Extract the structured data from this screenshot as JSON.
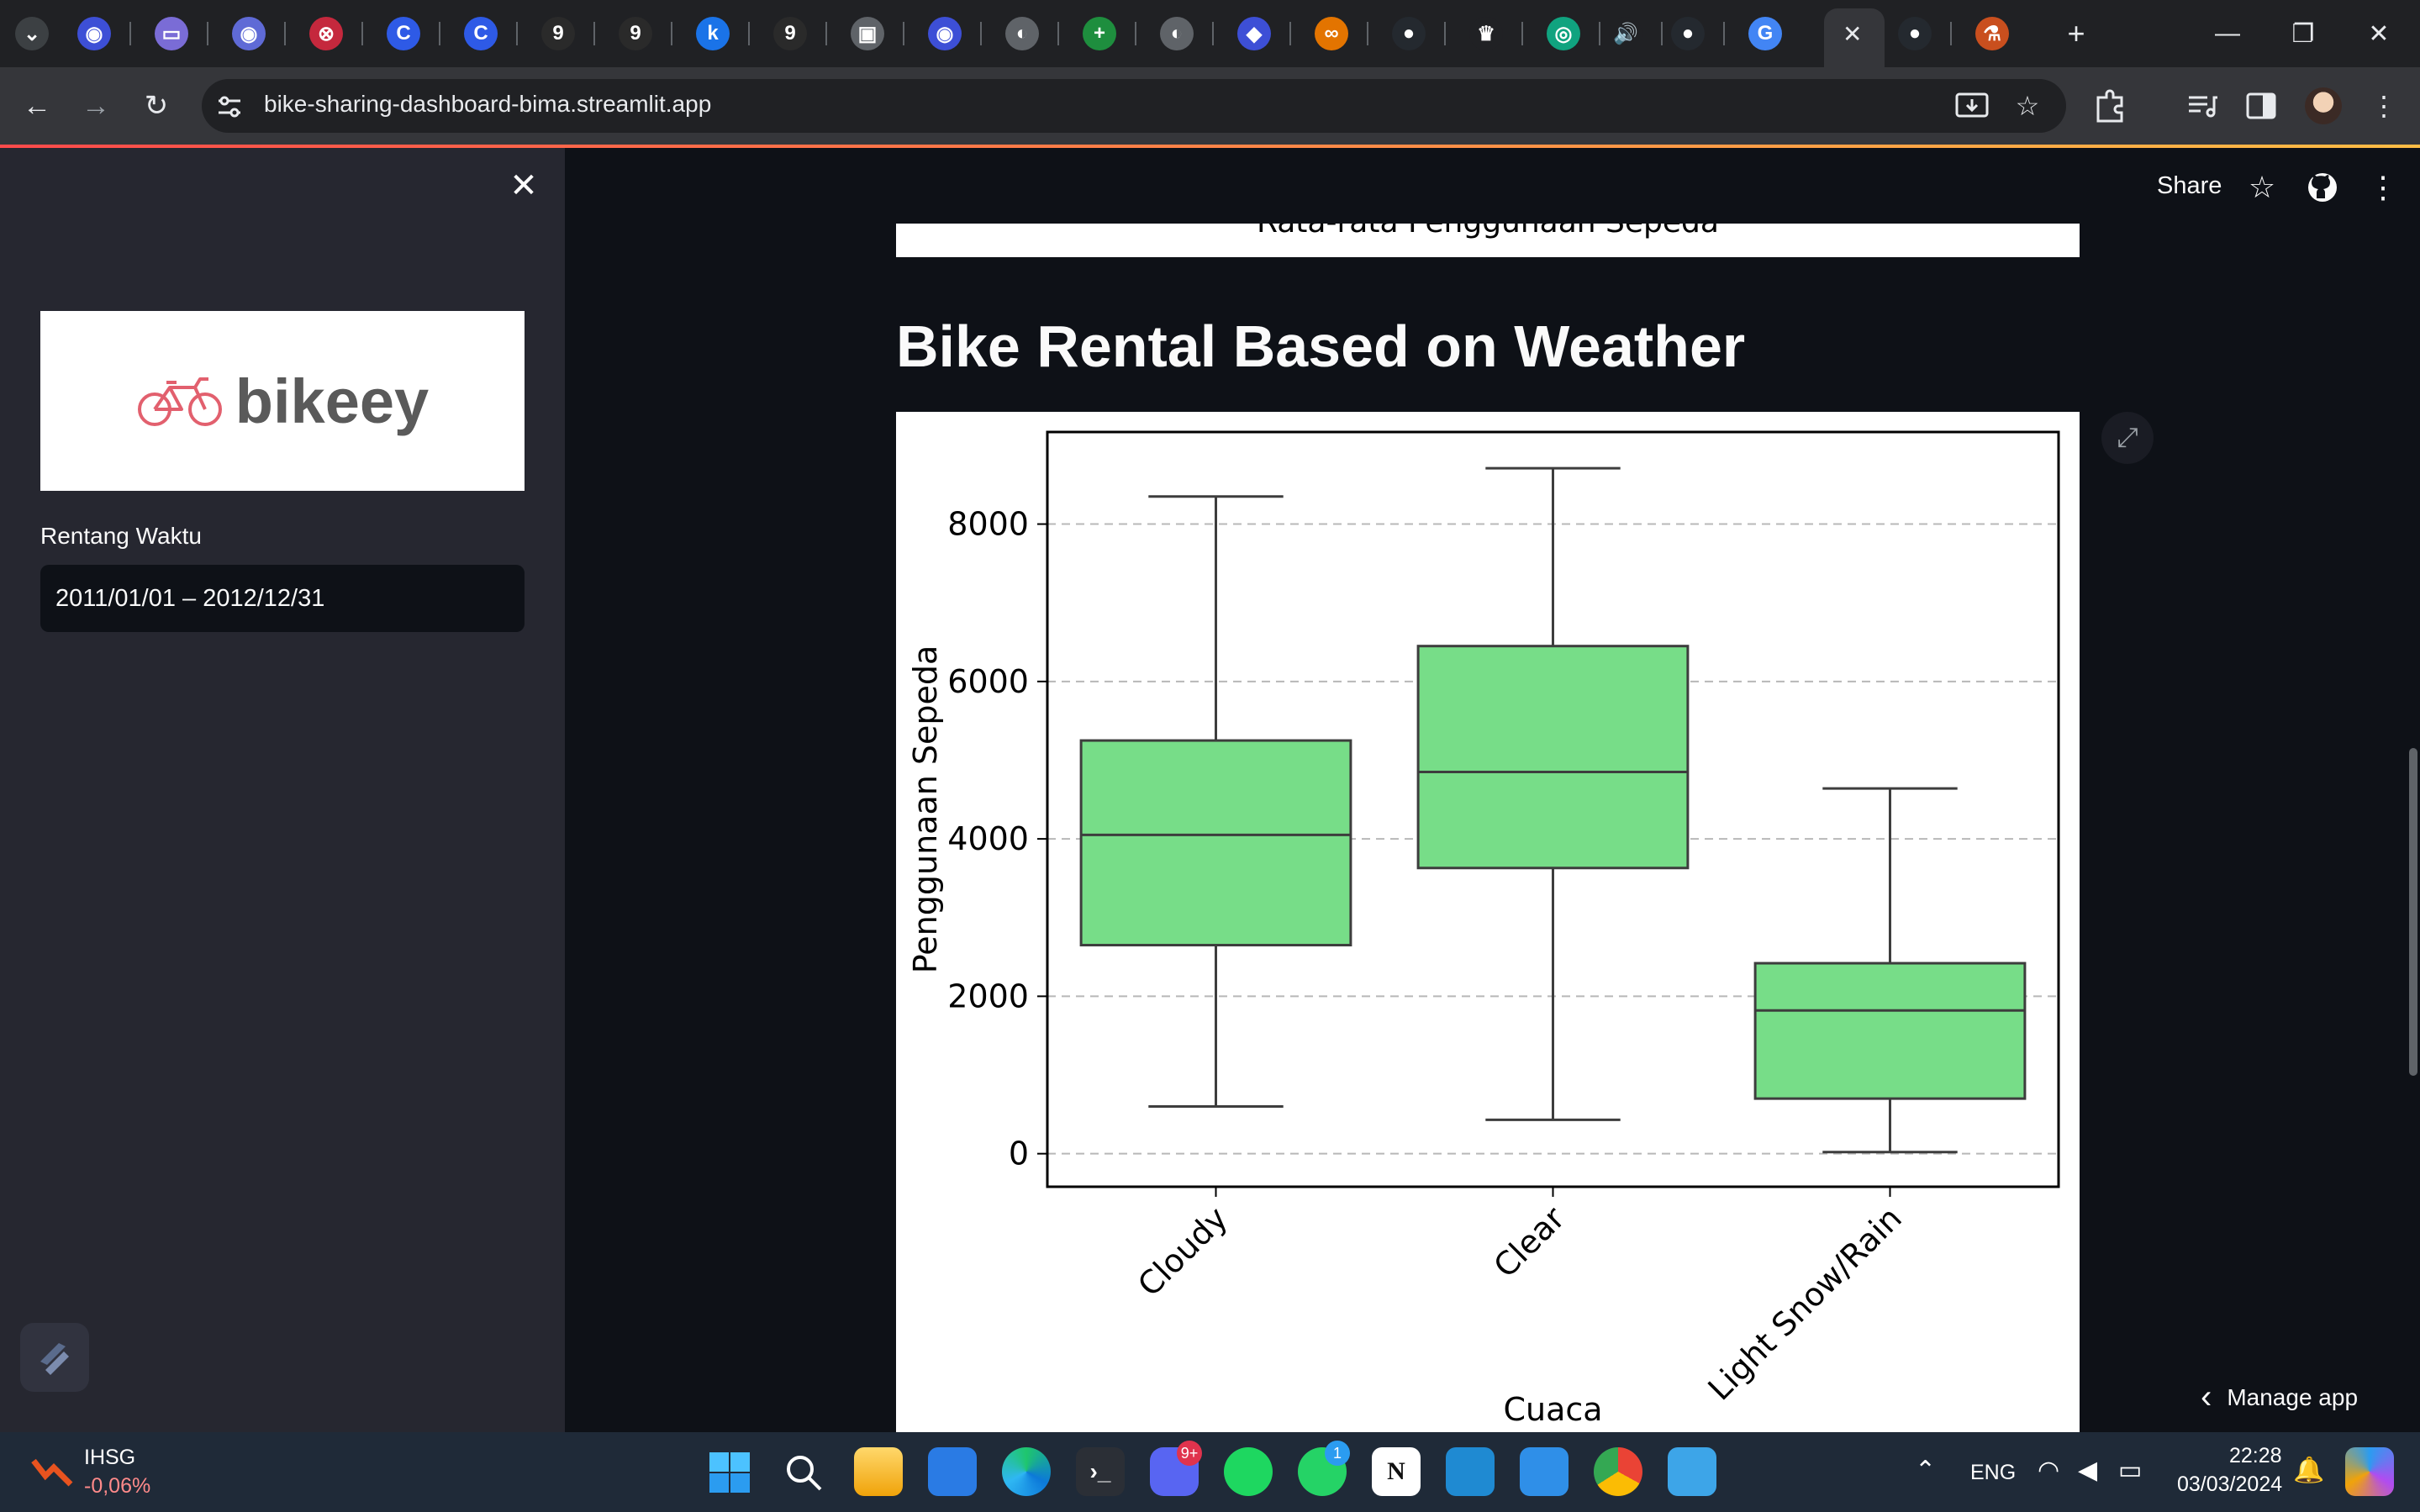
{
  "browser": {
    "tab_glyphs": [
      "⌄",
      "◉",
      "▭",
      "◉",
      "⊗",
      "C",
      "C",
      "9",
      "9",
      "k",
      "9",
      "▣",
      "◉",
      "◐",
      "+",
      "◐",
      "◆",
      "∞",
      "●",
      "♛",
      "◎",
      "🔊",
      "●",
      "G",
      "✕",
      "●",
      "⚗"
    ],
    "active_close": "✕",
    "new_tab": "+",
    "window_controls": {
      "minimize": "—",
      "restore": "❐",
      "close": "✕"
    },
    "nav": {
      "back": "←",
      "forward": "→",
      "reload": "↻"
    },
    "site_info_icon": "tune-icon",
    "url": "bike-sharing-dashboard-bima.streamlit.app"
  },
  "sidebar": {
    "close_glyph": "✕",
    "logo_text": "bikeey",
    "date_range_label": "Rentang Waktu",
    "date_range_value": "2011/01/01 – 2012/12/31"
  },
  "header": {
    "share_label": "Share",
    "star_glyph": "☆",
    "more_glyph": "⋮"
  },
  "main": {
    "previous_chart_title": "Rata-rata Penggunaan Sepeda",
    "section_title": "Bike Rental Based on Weather",
    "expand_glyph": "⤢",
    "manage_app_label": "Manage app",
    "manage_chevron": "‹"
  },
  "chart_data": {
    "type": "box",
    "categories": [
      "Cloudy",
      "Clear",
      "Light Snow/Rain"
    ],
    "boxes": [
      {
        "category": "Cloudy",
        "whisker_low": 600,
        "q1": 2650,
        "median": 4050,
        "q3": 5250,
        "whisker_high": 8350
      },
      {
        "category": "Clear",
        "whisker_low": 430,
        "q1": 3630,
        "median": 4850,
        "q3": 6450,
        "whisker_high": 8710
      },
      {
        "category": "Light Snow/Rain",
        "whisker_low": 20,
        "q1": 700,
        "median": 1820,
        "q3": 2420,
        "whisker_high": 4640
      }
    ],
    "xlabel": "Cuaca",
    "ylabel": "Penggunaan Sepeda",
    "ylim": [
      -420,
      9170
    ],
    "yticks": [
      0,
      2000,
      4000,
      6000,
      8000
    ],
    "grid": "horizontal dashed",
    "box_color": "#77dd88",
    "line_color": "#3d3d3d"
  },
  "taskbar": {
    "ticker_name": "IHSG",
    "ticker_change": "-0,06%",
    "lang": "ENG",
    "time": "22:28",
    "date": "03/03/2024",
    "discord_badge": "9+",
    "whatsapp_badge": "1",
    "notion_glyph": "N"
  }
}
